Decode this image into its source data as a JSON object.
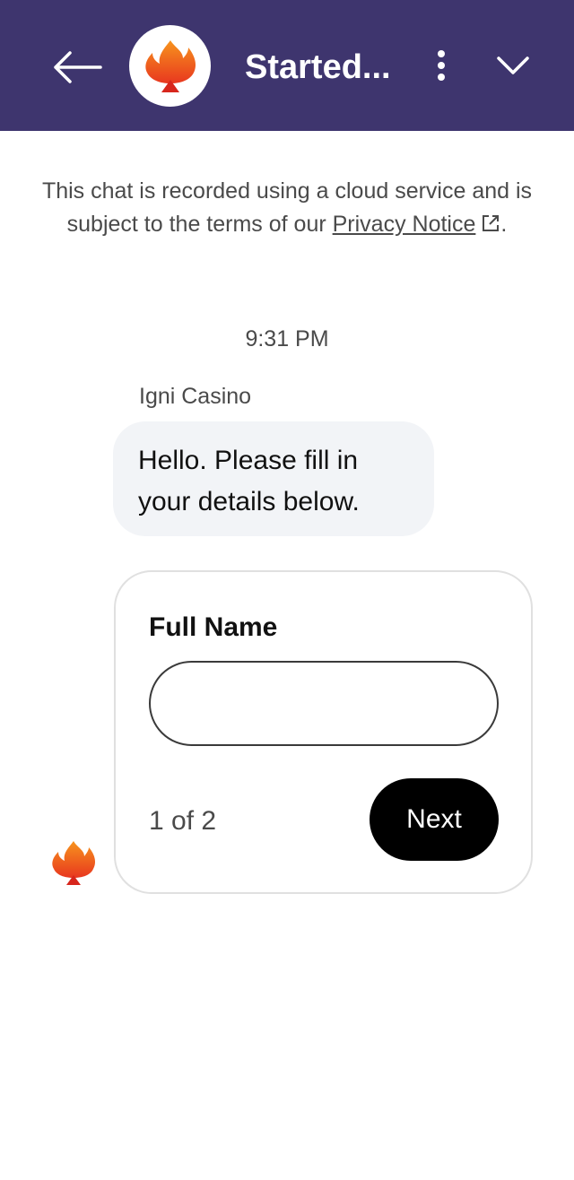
{
  "header": {
    "title": "Started...",
    "background": "#3e356e",
    "back_icon": "arrow-left-icon",
    "more_icon": "more-vertical-icon",
    "collapse_icon": "chevron-down-icon",
    "logo": "flame-spade-logo"
  },
  "notice": {
    "text": "This chat is recorded using a cloud service and is subject to the terms of our",
    "link": "Privacy Notice",
    "link_icon": "external-link-icon",
    "end": "."
  },
  "chat": {
    "timestamp": "9:31 PM",
    "sender": "Igni Casino",
    "message": "Hello. Please fill in your details below.",
    "bubble_color": "#f2f4f7"
  },
  "form": {
    "label": "Full Name",
    "value": "",
    "placeholder": "",
    "pager": "1 of 2",
    "next_label": "Next",
    "next_color": "#000000"
  }
}
